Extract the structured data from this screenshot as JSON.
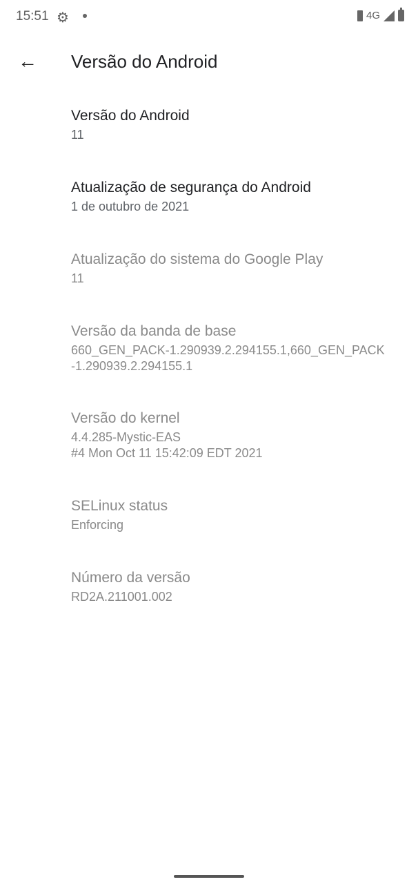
{
  "status_bar": {
    "time": "15:51",
    "network": "4G",
    "icons": [
      "gear-icon",
      "notification-dot-icon",
      "vibrate-icon",
      "signal-icon",
      "battery-icon"
    ]
  },
  "header": {
    "title": "Versão do Android",
    "back_icon": "arrow-back-icon"
  },
  "items": [
    {
      "title": "Versão do Android",
      "summary": "11",
      "enabled": true
    },
    {
      "title": "Atualização de segurança do Android",
      "summary": "1 de outubro de 2021",
      "enabled": true
    },
    {
      "title": "Atualização do sistema do Google Play",
      "summary": "11",
      "enabled": false
    },
    {
      "title": "Versão da banda de base",
      "summary": "660_GEN_PACK-1.290939.2.294155.1,660_GEN_PACK\n-1.290939.2.294155.1",
      "enabled": false
    },
    {
      "title": "Versão do kernel",
      "summary": "4.4.285-Mystic-EAS\n#4 Mon Oct 11 15:42:09 EDT 2021",
      "enabled": false
    },
    {
      "title": "SELinux status",
      "summary": "Enforcing",
      "enabled": false
    },
    {
      "title": "Número da versão",
      "summary": "RD2A.211001.002",
      "enabled": false
    }
  ]
}
